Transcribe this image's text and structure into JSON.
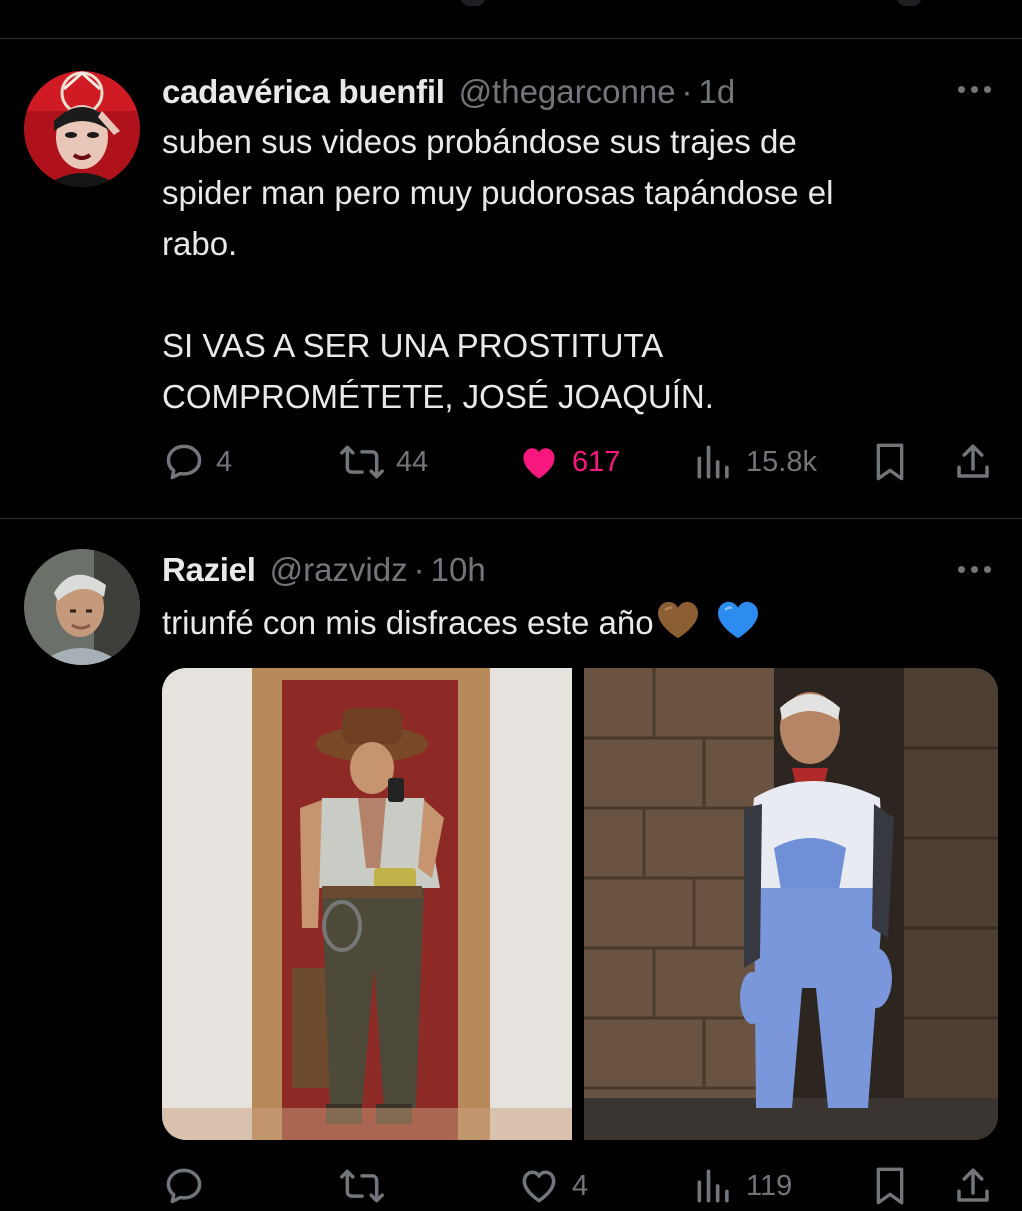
{
  "tweets": [
    {
      "name": "cadavérica buenfil",
      "handle": "@thegarconne",
      "separator": "·",
      "time": "1d",
      "text_lines": [
        "suben sus videos probándose sus trajes de",
        "spider man pero muy pudorosas tapándose el",
        "rabo.",
        "",
        "SI VAS A SER UNA PROSTITUTA",
        "COMPROMÉTETE, JOSÉ JOAQUÍN."
      ],
      "replies": "4",
      "reposts": "44",
      "likes": "617",
      "views": "15.8k",
      "liked": true
    },
    {
      "name": "Raziel",
      "handle": "@razvidz",
      "separator": "·",
      "time": "10h",
      "text": "triunfé con mis disfraces este año",
      "emojis": [
        "brown-heart",
        "blue-heart"
      ],
      "replies": "",
      "reposts": "",
      "likes": "4",
      "views": "119",
      "liked": false,
      "media": [
        "photo-indiana-jones-costume-mirror-selfie",
        "photo-evangelion-plugsuit-costume"
      ]
    }
  ],
  "colors": {
    "background": "#000000",
    "text": "#e7e9ea",
    "secondary": "#71767b",
    "like": "#f91880",
    "divider": "#2f3336"
  }
}
